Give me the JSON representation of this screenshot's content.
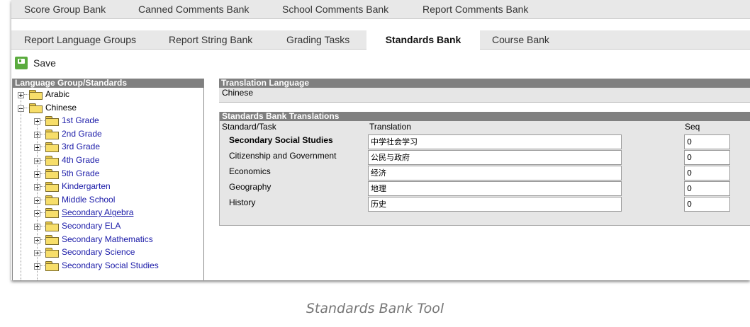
{
  "tabs_row1": [
    "Score Group Bank",
    "Canned Comments Bank",
    "School Comments Bank",
    "Report Comments Bank"
  ],
  "tabs_row2": [
    "Report Language Groups",
    "Report String Bank",
    "Grading Tasks",
    "Standards Bank",
    "Course Bank"
  ],
  "active_tab": "Standards Bank",
  "toolbar": {
    "save_label": "Save"
  },
  "left_panel": {
    "header": "Language Group/Standards",
    "top_nodes": [
      {
        "label": "Arabic",
        "expanded": false
      },
      {
        "label": "Chinese",
        "expanded": true
      }
    ],
    "children": [
      {
        "label": "1st Grade",
        "underline": false
      },
      {
        "label": "2nd Grade",
        "underline": false
      },
      {
        "label": "3rd Grade",
        "underline": false
      },
      {
        "label": "4th Grade",
        "underline": false
      },
      {
        "label": "5th Grade",
        "underline": false
      },
      {
        "label": "Kindergarten",
        "underline": false
      },
      {
        "label": "Middle School",
        "underline": false
      },
      {
        "label": "Secondary Algebra",
        "underline": true
      },
      {
        "label": "Secondary ELA",
        "underline": false
      },
      {
        "label": "Secondary Mathematics",
        "underline": false
      },
      {
        "label": "Secondary Science",
        "underline": false
      },
      {
        "label": "Secondary Social Studies",
        "underline": false
      }
    ]
  },
  "translation_language": {
    "header": "Translation Language",
    "value": "Chinese"
  },
  "standards_translations": {
    "header": "Standards Bank Translations",
    "columns": {
      "standard": "Standard/Task",
      "translation": "Translation",
      "seq": "Seq"
    },
    "rows": [
      {
        "standard": "Secondary Social Studies",
        "translation": "中学社会学习",
        "seq": "0",
        "bold": true
      },
      {
        "standard": "Citizenship and Government",
        "translation": "公民与政府",
        "seq": "0",
        "bold": false
      },
      {
        "standard": "Economics",
        "translation": "经济",
        "seq": "0",
        "bold": false
      },
      {
        "standard": "Geography",
        "translation": "地理",
        "seq": "0",
        "bold": false
      },
      {
        "standard": "History",
        "translation": "历史",
        "seq": "0",
        "bold": false
      }
    ]
  },
  "caption": "Standards Bank Tool"
}
